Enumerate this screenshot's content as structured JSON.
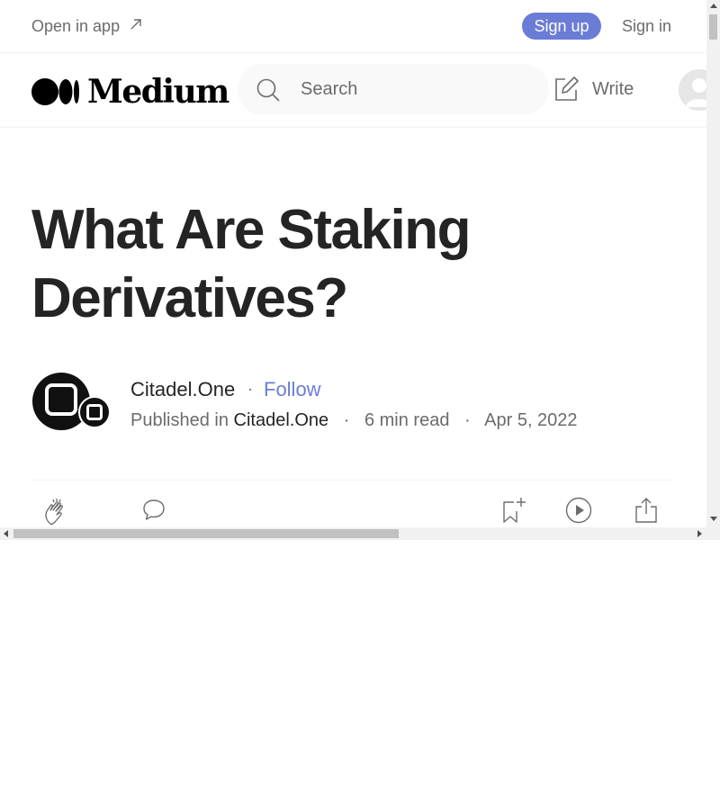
{
  "topbar": {
    "open_in_app": "Open in app",
    "sign_up": "Sign up",
    "sign_in": "Sign in"
  },
  "header": {
    "logo_text": "Medium",
    "search_placeholder": "Search",
    "write_label": "Write"
  },
  "article": {
    "title": "What Are Staking Derivatives?",
    "author": "Citadel.One",
    "follow_label": "Follow",
    "published_in_label": "Published in",
    "publication": "Citadel.One",
    "read_time": "6 min read",
    "date": "Apr 5, 2022"
  },
  "colors": {
    "accent": "#6b7cd6",
    "text": "#242424",
    "muted": "#6b6b6b"
  },
  "icons": {
    "open_in_app": "arrow-up-right-icon",
    "search": "search-icon",
    "write": "write-icon",
    "clap": "clap-icon",
    "comment": "comment-icon",
    "save": "bookmark-add-icon",
    "listen": "play-icon",
    "share": "share-icon"
  }
}
